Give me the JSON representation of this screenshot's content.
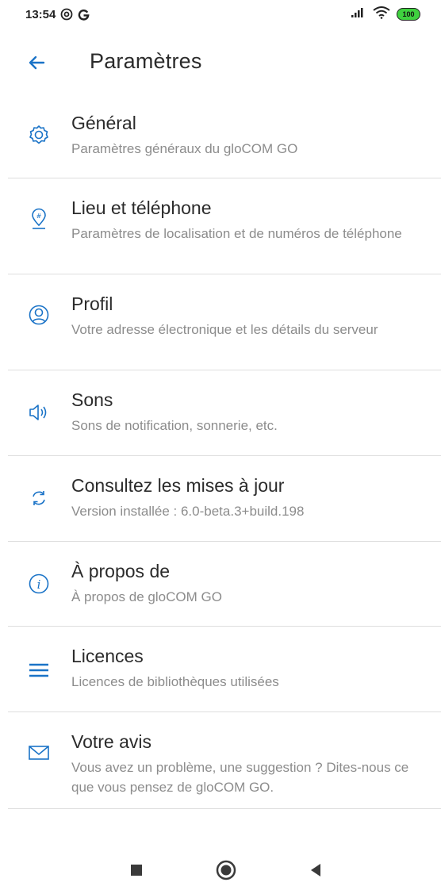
{
  "status_bar": {
    "time": "13:54",
    "battery": "100",
    "icons": [
      "at-icon",
      "g-app-icon",
      "signal-icon",
      "wifi-icon",
      "battery-icon"
    ]
  },
  "app_bar": {
    "title": "Paramètres",
    "back_icon": "arrow-left-icon"
  },
  "settings": [
    {
      "title": "Général",
      "subtitle": "Paramètres généraux du gloCOM GO",
      "icon": "gear-icon"
    },
    {
      "title": "Lieu et téléphone",
      "subtitle": "Paramètres de localisation et de numéros de téléphone",
      "icon": "location-phone-icon"
    },
    {
      "title": "Profil",
      "subtitle": "Votre adresse électronique et les détails du serveur",
      "icon": "profile-icon"
    },
    {
      "title": "Sons",
      "subtitle": "Sons de notification, sonnerie, etc.",
      "icon": "speaker-icon"
    },
    {
      "title": "Consultez les mises à jour",
      "subtitle": "Version installée : 6.0-beta.3+build.198",
      "icon": "refresh-icon"
    },
    {
      "title": "À propos de",
      "subtitle": "À propos de gloCOM GO",
      "icon": "info-icon"
    },
    {
      "title": "Licences",
      "subtitle": "Licences de bibliothèques utilisées",
      "icon": "menu-icon"
    },
    {
      "title": "Votre avis",
      "subtitle": "Vous avez un problème, une suggestion ? Dites-nous ce que vous pensez de gloCOM GO.",
      "icon": "envelope-icon"
    }
  ],
  "colors": {
    "accent": "#1a73c7",
    "title_text": "#2b2b2b",
    "subtitle_text": "#8c8c8c",
    "divider": "#dedede"
  },
  "nav_bar": {
    "icons": [
      "recents-square-icon",
      "home-circle-icon",
      "back-triangle-icon"
    ]
  }
}
